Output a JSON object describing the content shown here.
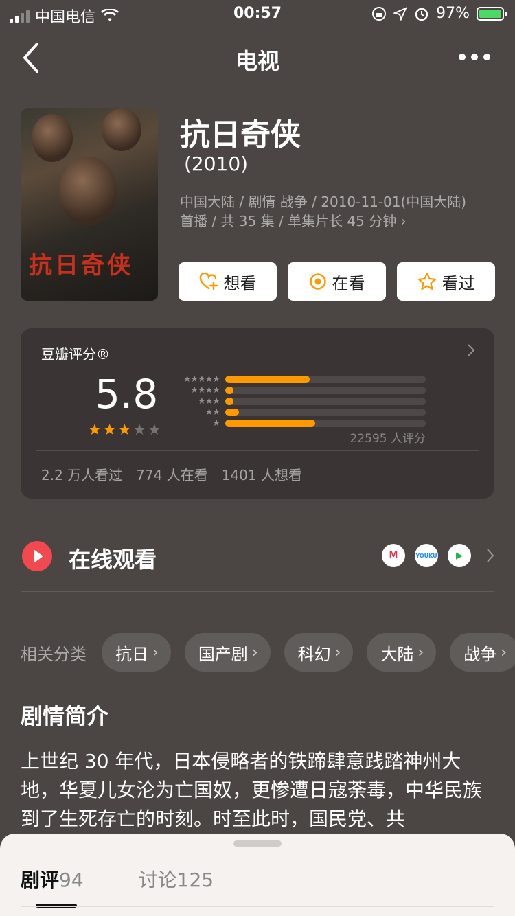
{
  "status_bar": {
    "carrier": "中国电信",
    "time": "00:57",
    "battery": "97%"
  },
  "nav": {
    "title": "电视"
  },
  "show": {
    "title": "抗日奇侠",
    "year": "(2010)",
    "meta_line1": "中国大陆 / 剧情 战争 / 2010-11-01(中国大陆)",
    "meta_line2": "首播 / 共 35 集 / 单集片长 45 分钟",
    "poster_title": "抗日奇侠"
  },
  "actions": {
    "want": "想看",
    "watching": "在看",
    "watched": "看过"
  },
  "rating": {
    "label": "豆瓣评分®",
    "score": "5.8",
    "stars_filled": 3,
    "stars_total": 5,
    "distribution": [
      {
        "stars": "★★★★★",
        "fraction": 0.42
      },
      {
        "stars": "★★★★",
        "fraction": 0.04
      },
      {
        "stars": "★★★",
        "fraction": 0.04
      },
      {
        "stars": "★★",
        "fraction": 0.07
      },
      {
        "stars": "★",
        "fraction": 0.45
      }
    ],
    "count": "22595 人评分",
    "stats": [
      "2.2 万人看过",
      "774 人在看",
      "1401 人想看"
    ]
  },
  "online": {
    "label": "在线观看",
    "providers": [
      "M",
      "YOUKU",
      "▶"
    ]
  },
  "related": {
    "label": "相关分类",
    "tags": [
      "抗日",
      "国产剧",
      "科幻",
      "大陆",
      "战争"
    ]
  },
  "synopsis": {
    "title": "剧情简介",
    "text": "上世纪 30 年代，日本侵略者的铁蹄肆意践踏神州大地，华夏儿女沦为亡国奴，更惨遭日寇荼毒，中华民族到了生死存亡的时刻。时至此时，国民党、共"
  },
  "sheet": {
    "tab1_label": "剧评",
    "tab1_count": "94",
    "tab2_label": "讨论",
    "tab2_count": "125"
  },
  "colors": {
    "accent": "#ff9900",
    "background": "#4b4644",
    "card": "#3a3534",
    "play_red": "#f2484f"
  }
}
